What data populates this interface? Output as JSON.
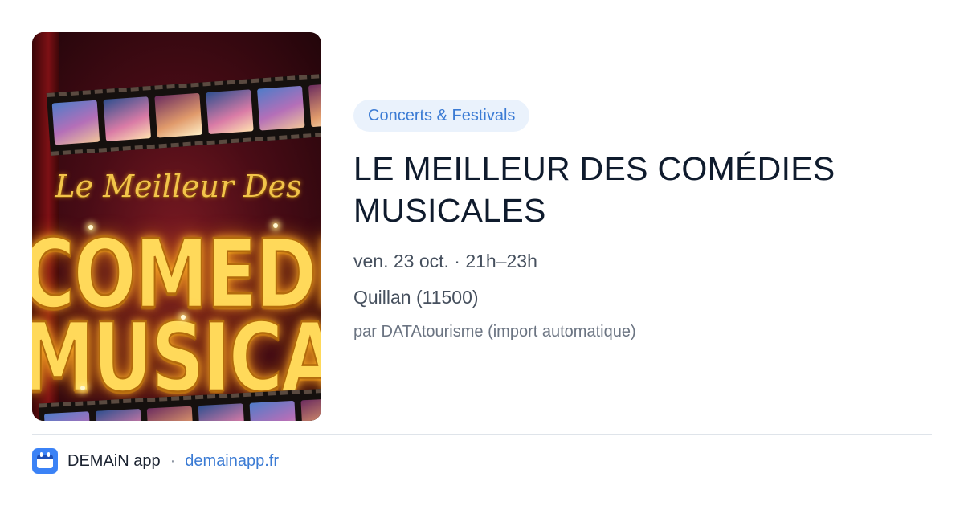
{
  "poster": {
    "script_text": "Le Meilleur Des",
    "line1": "COMEDIES",
    "line2": "MUSICALES"
  },
  "event": {
    "category": "Concerts & Festivals",
    "title_line1": "LE MEILLEUR DES COMÉDIES",
    "title_line2": "MUSICALES",
    "datetime": "ven. 23 oct. · 21h–23h",
    "location": "Quillan (11500)",
    "source": "par DATAtourisme (import automatique)"
  },
  "footer": {
    "app_name": "DEMAiN app",
    "separator": "·",
    "site": "demainapp.fr"
  },
  "colors": {
    "accent": "#3b7bd4",
    "chip_bg": "#eaf2fc",
    "title": "#0f1b2d"
  }
}
